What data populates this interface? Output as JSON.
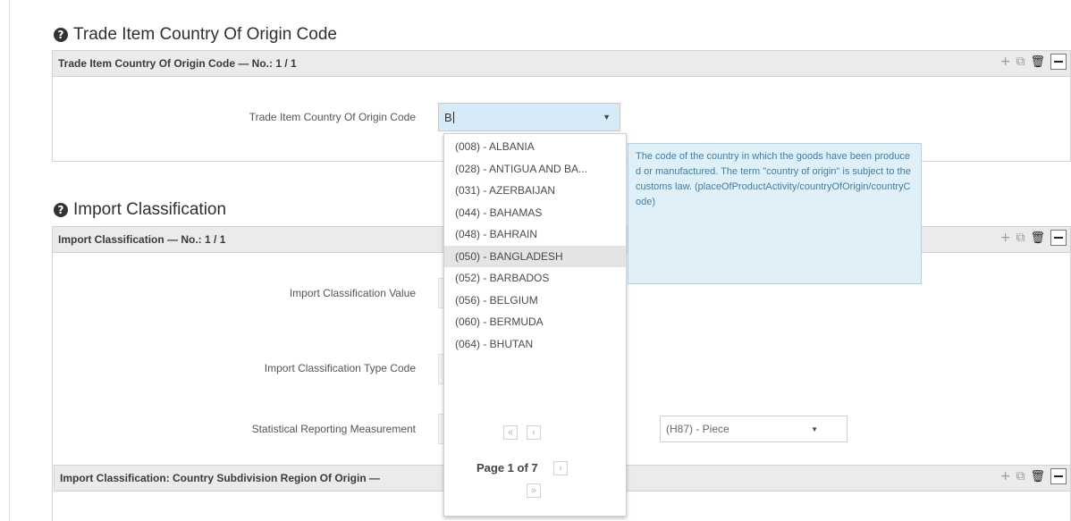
{
  "sections": {
    "origin": {
      "title": "Trade Item Country Of Origin Code",
      "panel_header": "Trade Item Country Of Origin Code — No.: 1 / 1",
      "field_label": "Trade Item Country Of Origin Code",
      "field_value": "B"
    },
    "import": {
      "title": "Import Classification",
      "panel_header": "Import Classification — No.: 1 / 1",
      "value_label": "Import Classification Value",
      "type_code_label": "Import Classification Type Code",
      "stat_label": "Statistical Reporting Measurement",
      "stat_value": "(H87) - Piece",
      "sub_header": "Import Classification: Country Subdivision Region Of Origin —"
    }
  },
  "dropdown": {
    "items": [
      "(008) - ALBANIA",
      "(028) - ANTIGUA AND BA...",
      "(031) - AZERBAIJAN",
      "(044) - BAHAMAS",
      "(048) - BAHRAIN",
      "(050) - BANGLADESH",
      "(052) - BARBADOS",
      "(056) - BELGIUM",
      "(060) - BERMUDA",
      "(064) - BHUTAN"
    ],
    "active_index": 5,
    "page_label": "Page 1 of 7",
    "first_glyph": "«",
    "prev_glyph": "‹",
    "next_glyph": "›",
    "last_glyph": "»"
  },
  "tooltip": {
    "text": "The code of the country in which the goods have been produced or manufactured. The term \"country of origin\" is subject to the customs law. (placeOfProductActivity/countryOfOrigin/countryCode)"
  },
  "icons": {
    "help": "?",
    "add": "+",
    "copy": "⧉",
    "trash": "🗑",
    "caret": "▼"
  },
  "colors": {
    "tooltip_bg": "#dff0f8",
    "tooltip_text": "#3f7ea3",
    "input_highlight": "#d6ebf7"
  }
}
